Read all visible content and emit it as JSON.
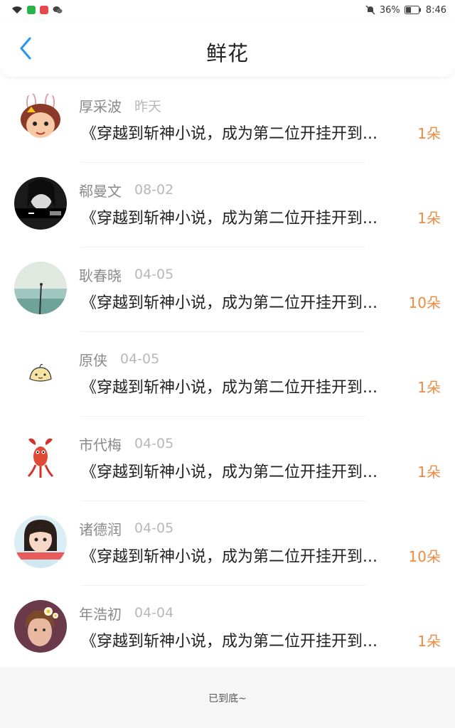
{
  "status_bar": {
    "battery": "36%",
    "time": "8:46"
  },
  "header": {
    "title": "鲜花"
  },
  "items": [
    {
      "name": "厚采波",
      "date": "昨天",
      "title": "《穿越到斩神小说，成为第二位开挂开到...",
      "count": "1朵"
    },
    {
      "name": "郗曼文",
      "date": "08-02",
      "title": "《穿越到斩神小说，成为第二位开挂开到...",
      "count": "1朵"
    },
    {
      "name": "耿春晓",
      "date": "04-05",
      "title": "《穿越到斩神小说，成为第二位开挂开到...",
      "count": "10朵"
    },
    {
      "name": "原侠",
      "date": "04-05",
      "title": "《穿越到斩神小说，成为第二位开挂开到...",
      "count": "1朵"
    },
    {
      "name": "市代梅",
      "date": "04-05",
      "title": "《穿越到斩神小说，成为第二位开挂开到...",
      "count": "1朵"
    },
    {
      "name": "诸德润",
      "date": "04-05",
      "title": "《穿越到斩神小说，成为第二位开挂开到...",
      "count": "10朵"
    },
    {
      "name": "年浩初",
      "date": "04-04",
      "title": "《穿越到斩神小说，成为第二位开挂开到...",
      "count": "1朵"
    }
  ],
  "footer": {
    "text": "已到底~"
  },
  "colors": {
    "accent": "#f08a3e",
    "back_icon": "#2196f3"
  }
}
